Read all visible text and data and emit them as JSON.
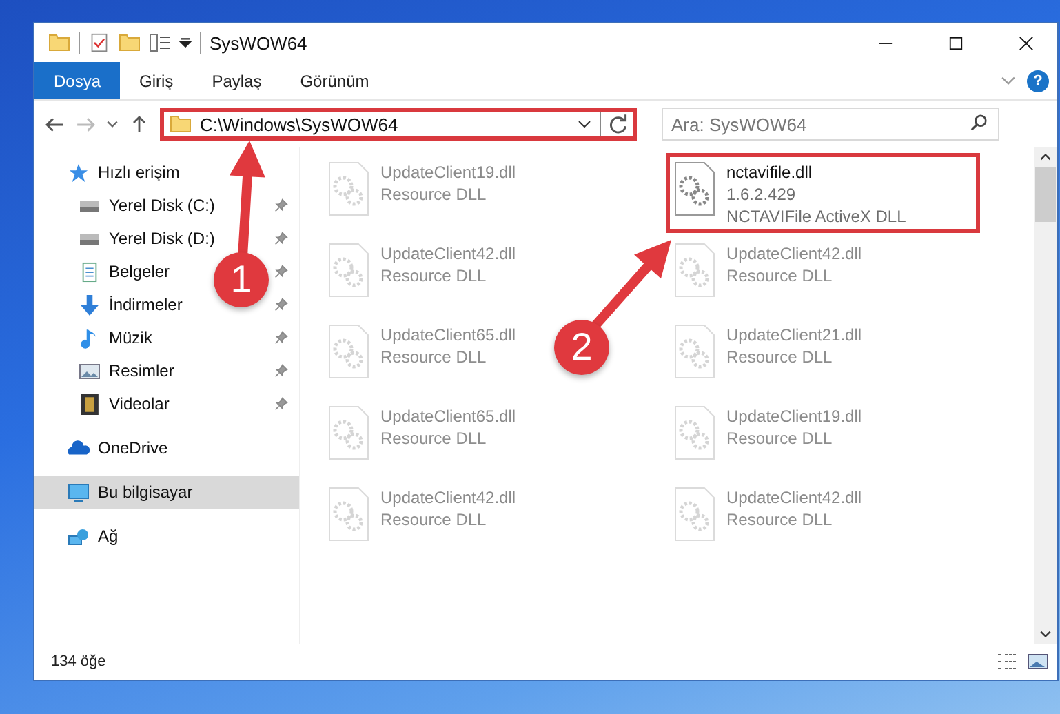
{
  "window": {
    "title": "SysWOW64"
  },
  "ribbon_tabs": [
    {
      "label": "Dosya",
      "selected": true
    },
    {
      "label": "Giriş",
      "selected": false
    },
    {
      "label": "Paylaş",
      "selected": false
    },
    {
      "label": "Görünüm",
      "selected": false
    }
  ],
  "help_button": "?",
  "address_bar": {
    "path": "C:\\Windows\\SysWOW64",
    "highlighted": true
  },
  "search": {
    "placeholder": "Ara: SysWOW64"
  },
  "sidebar": {
    "items": [
      {
        "label": "Hızlı erişim",
        "selected": false,
        "children": [
          {
            "label": "Yerel Disk (C:)",
            "pinned": true
          },
          {
            "label": "Yerel Disk (D:)",
            "pinned": true
          },
          {
            "label": "Belgeler",
            "pinned": true
          },
          {
            "label": "İndirmeler",
            "pinned": true
          },
          {
            "label": "Müzik",
            "pinned": true
          },
          {
            "label": "Resimler",
            "pinned": true
          },
          {
            "label": "Videolar",
            "pinned": true
          }
        ]
      },
      {
        "label": "OneDrive",
        "selected": false
      },
      {
        "label": "Bu bilgisayar",
        "selected": true
      },
      {
        "label": "Ağ",
        "selected": false
      }
    ]
  },
  "files": [
    {
      "name": "UpdateClient19.dll",
      "line_2": "Resource DLL",
      "highlighted": false
    },
    {
      "name": "nctavifile.dll",
      "line_2": "1.6.2.429",
      "line_3": "NCTAVIFile ActiveX DLL",
      "highlighted": true
    },
    {
      "name": "UpdateClient42.dll",
      "line_2": "Resource DLL",
      "highlighted": false
    },
    {
      "name": "UpdateClient42.dll",
      "line_2": "Resource DLL",
      "highlighted": false
    },
    {
      "name": "UpdateClient65.dll",
      "line_2": "Resource DLL",
      "highlighted": false
    },
    {
      "name": "UpdateClient21.dll",
      "line_2": "Resource DLL",
      "highlighted": false
    },
    {
      "name": "UpdateClient65.dll",
      "line_2": "Resource DLL",
      "highlighted": false
    },
    {
      "name": "UpdateClient19.dll",
      "line_2": "Resource DLL",
      "highlighted": false
    },
    {
      "name": "UpdateClient42.dll",
      "line_2": "Resource DLL",
      "highlighted": false
    },
    {
      "name": "UpdateClient42.dll",
      "line_2": "Resource DLL",
      "highlighted": false
    }
  ],
  "status_bar": {
    "count": "134 öğe"
  },
  "annotations": [
    {
      "number": "1"
    },
    {
      "number": "2"
    }
  ]
}
